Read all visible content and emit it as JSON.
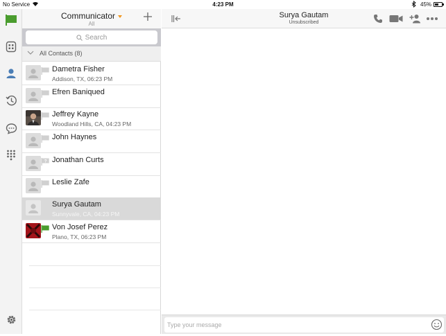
{
  "status_bar": {
    "carrier": "No Service",
    "time": "4:23 PM",
    "battery": "45%"
  },
  "nav": {
    "items": [
      {
        "icon": "flag-icon"
      },
      {
        "icon": "directory-icon"
      },
      {
        "icon": "contacts-icon"
      },
      {
        "icon": "history-icon"
      },
      {
        "icon": "chat-icon"
      },
      {
        "icon": "dialpad-icon"
      },
      {
        "icon": "settings-icon"
      }
    ],
    "accent": "#4a9c2e"
  },
  "contacts": {
    "title": "Communicator",
    "subtitle": "All",
    "search_placeholder": "Search",
    "group_label": "All Contacts (8)",
    "items": [
      {
        "name": "Dametra Fisher",
        "location": "Addison, TX, 06:23 PM"
      },
      {
        "name": "Efren Baniqued",
        "location": ""
      },
      {
        "name": "Jeffrey Kayne",
        "location": "Woodland Hills, CA, 04:23 PM"
      },
      {
        "name": "John Haynes",
        "location": ""
      },
      {
        "name": "Jonathan Curts",
        "location": ""
      },
      {
        "name": "Leslie Zafe",
        "location": ""
      },
      {
        "name": "Surya Gautam",
        "location": "Sunnyvale, CA, 04:23 PM"
      },
      {
        "name": "Von Josef Perez",
        "location": "Plano, TX, 06:23 PM"
      }
    ]
  },
  "chat": {
    "name": "Surya Gautam",
    "status": "Unsubscribed",
    "message_placeholder": "Type your message"
  }
}
